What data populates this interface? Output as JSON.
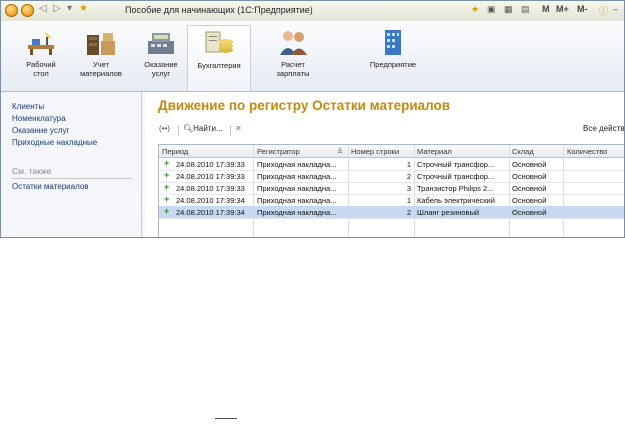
{
  "window": {
    "title": "Пособие для начинающих  (1С:Предприятие)",
    "m_buttons": [
      "M",
      "M+",
      "M-"
    ]
  },
  "sections": [
    {
      "label": "Рабочий\nстол",
      "icon": "desk-icon"
    },
    {
      "label": "Учет\nматериалов",
      "icon": "warehouse-icon"
    },
    {
      "label": "Оказание\nуслуг",
      "icon": "cash-register-icon"
    },
    {
      "label": "Бухгалтерия",
      "icon": "accounting-icon"
    },
    {
      "label": "Расчет\nзарплаты",
      "icon": "people-icon"
    },
    {
      "label": "Предприятие",
      "icon": "building-icon"
    }
  ],
  "nav": {
    "items": [
      "Клиенты",
      "Номенклатура",
      "Оказание услуг",
      "Приходные накладные"
    ],
    "see_also": "См. также",
    "see_also_items": [
      "Остатки материалов"
    ]
  },
  "content": {
    "title": "Движение по регистру Остатки материалов",
    "cmd": {
      "find": "Найти...",
      "all_actions": "Все действия"
    },
    "columns": [
      "Период",
      "Регистратор",
      "Номер строки",
      "Материал",
      "Склад",
      "Количество"
    ],
    "rows": [
      {
        "period": "24.08.2010 17:39:33",
        "registrar": "Приходная накладна...",
        "line": "1",
        "material": "Строчный трансфор...",
        "warehouse": "Основной",
        "qty": ""
      },
      {
        "period": "24.08.2010 17:39:33",
        "registrar": "Приходная накладна...",
        "line": "2",
        "material": "Строчный трансфор...",
        "warehouse": "Основной",
        "qty": ""
      },
      {
        "period": "24.08.2010 17:39:33",
        "registrar": "Приходная накладна...",
        "line": "3",
        "material": "Транзистор Philips 2...",
        "warehouse": "Основной",
        "qty": ""
      },
      {
        "period": "24.08.2010 17:39:34",
        "registrar": "Приходная накладна...",
        "line": "1",
        "material": "Кабель электрический",
        "warehouse": "Основной",
        "qty": ""
      },
      {
        "period": "24.08.2010 17:39:34",
        "registrar": "Приходная накладна...",
        "line": "2",
        "material": "Шланг резиновый",
        "warehouse": "Основной",
        "qty": ""
      }
    ],
    "selected_row": 4
  }
}
